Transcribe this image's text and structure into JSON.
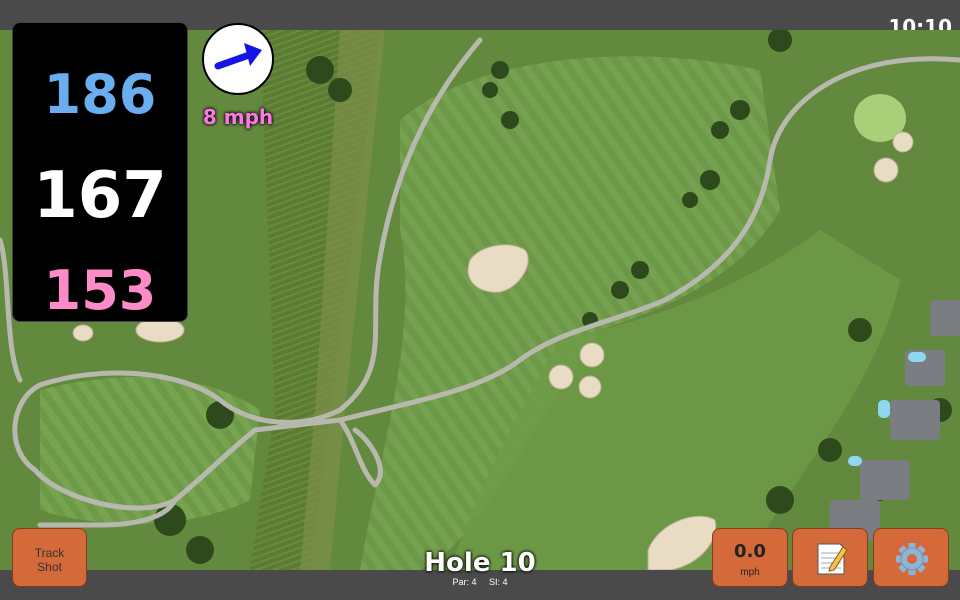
{
  "status_bar": {
    "time": "10:10"
  },
  "distances": {
    "back": "186",
    "middle": "167",
    "front": "153"
  },
  "wind": {
    "speed": "8 mph",
    "icon": "wind-direction-arrow-icon"
  },
  "hole": {
    "title": "Hole 10",
    "par": "Par: 4",
    "si": "SI: 4"
  },
  "buttons": {
    "track_shot": {
      "line1": "Track",
      "line2": "Shot"
    },
    "speed": {
      "value": "0.0",
      "unit": "mph"
    },
    "notes_icon": "notepad-icon",
    "settings_icon": "gear-icon"
  },
  "colors": {
    "back": "#6aaef0",
    "middle": "#ffffff",
    "front": "#ff8ac8",
    "wind": "#ff77e6",
    "button": "#d46a3a"
  }
}
